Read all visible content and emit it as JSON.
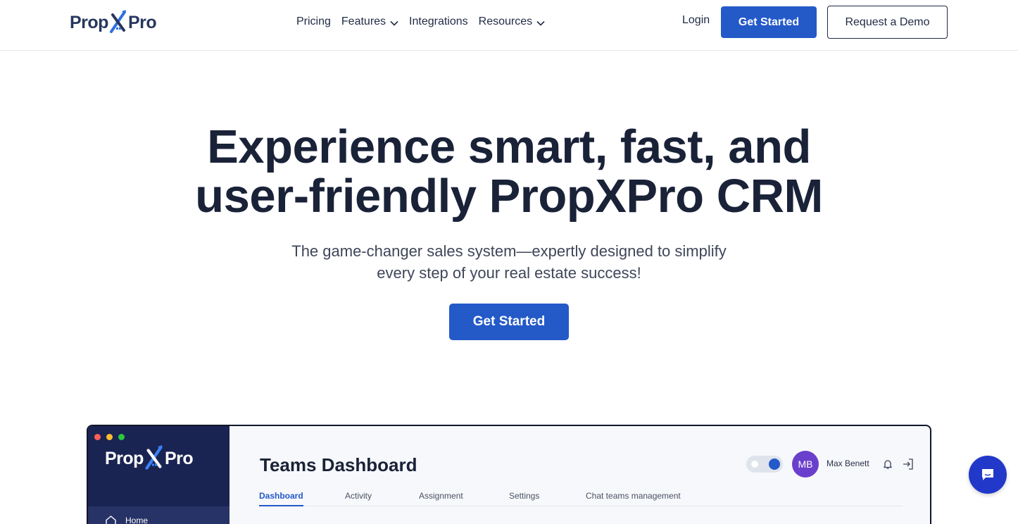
{
  "brand": {
    "name_part1": "Prop",
    "name_part2": "Pro",
    "accent_color": "#2459c8",
    "dark_color": "#1a2238"
  },
  "header": {
    "nav": [
      {
        "label": "Pricing",
        "has_dropdown": false
      },
      {
        "label": "Features",
        "has_dropdown": true
      },
      {
        "label": "Integrations",
        "has_dropdown": false
      },
      {
        "label": "Resources",
        "has_dropdown": true
      }
    ],
    "login_label": "Login",
    "get_started_label": "Get Started",
    "demo_label": "Request a Demo"
  },
  "hero": {
    "title_line1": "Experience smart, fast, and",
    "title_line2": "user-friendly PropXPro CRM",
    "subtitle_line1": "The game-changer sales system—expertly designed to simplify",
    "subtitle_line2": "every step of your real estate success!",
    "cta_label": "Get Started"
  },
  "preview": {
    "sidebar": {
      "home_label": "Home"
    },
    "title": "Teams Dashboard",
    "user": {
      "initials": "MB",
      "name": "Max Benett"
    },
    "tabs": [
      {
        "label": "Dashboard",
        "active": true
      },
      {
        "label": "Activity",
        "active": false
      },
      {
        "label": "Assignment",
        "active": false
      },
      {
        "label": "Settings",
        "active": false
      },
      {
        "label": "Chat teams management",
        "active": false
      }
    ]
  },
  "chat_widget": {
    "icon": "chat-bubble-icon"
  }
}
